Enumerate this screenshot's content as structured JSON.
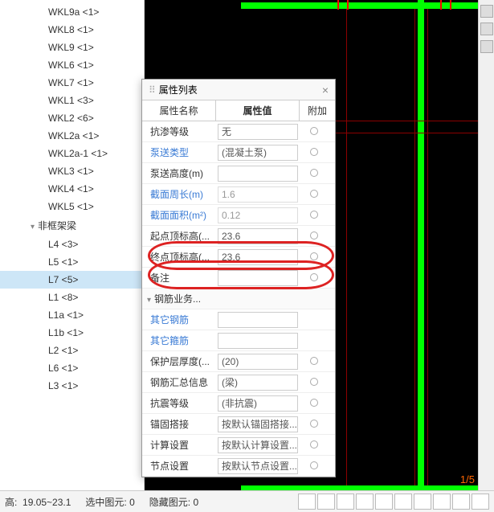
{
  "tree": {
    "items_top": [
      "WKL9a <1>",
      "WKL8 <1>",
      "WKL9 <1>",
      "WKL6 <1>",
      "WKL7 <1>",
      "WKL1 <3>",
      "WKL2 <6>",
      "WKL2a <1>",
      "WKL2a-1 <1>",
      "WKL3 <1>",
      "WKL4 <1>",
      "WKL5 <1>"
    ],
    "group": "非框架梁",
    "items_bot": [
      "L4 <3>",
      "L5 <1>",
      "L7 <5>",
      "L1 <8>",
      "L1a <1>",
      "L1b <1>",
      "L2 <1>",
      "L6 <1>",
      "L3 <1>"
    ],
    "selected": "L7 <5>"
  },
  "prop": {
    "title": "属性列表",
    "headers": {
      "name": "属性名称",
      "value": "属性值",
      "extra": "附加"
    },
    "rows": [
      {
        "name": "抗渗等级",
        "value": "无",
        "link": false,
        "readonly": false,
        "radio": true
      },
      {
        "name": "泵送类型",
        "value": "(混凝土泵)",
        "link": true,
        "readonly": false,
        "radio": true
      },
      {
        "name": "泵送高度(m)",
        "value": "",
        "link": false,
        "readonly": false,
        "radio": true
      },
      {
        "name": "截面周长(m)",
        "value": "1.6",
        "link": true,
        "readonly": true,
        "radio": true
      },
      {
        "name": "截面面积(m²)",
        "value": "0.12",
        "link": true,
        "readonly": true,
        "radio": true
      },
      {
        "name": "起点顶标高(...",
        "value": "23.6",
        "link": false,
        "readonly": false,
        "radio": true
      },
      {
        "name": "终点顶标高(...",
        "value": "23.6",
        "link": false,
        "readonly": false,
        "radio": true
      },
      {
        "name": "备注",
        "value": "",
        "link": false,
        "readonly": false,
        "radio": true
      }
    ],
    "group2": "钢筋业务...",
    "rows2": [
      {
        "name": "其它钢筋",
        "value": "",
        "link": true,
        "readonly": false,
        "radio": false
      },
      {
        "name": "其它箍筋",
        "value": "",
        "link": true,
        "readonly": false,
        "radio": false
      },
      {
        "name": "保护层厚度(...",
        "value": "(20)",
        "link": false,
        "readonly": false,
        "radio": true
      },
      {
        "name": "钢筋汇总信息",
        "value": "(梁)",
        "link": false,
        "readonly": false,
        "radio": true
      },
      {
        "name": "抗震等级",
        "value": "(非抗震)",
        "link": false,
        "readonly": false,
        "radio": true
      },
      {
        "name": "锚固搭接",
        "value": "按默认锚固搭接...",
        "link": false,
        "readonly": false,
        "radio": true
      },
      {
        "name": "计算设置",
        "value": "按默认计算设置...",
        "link": false,
        "readonly": false,
        "radio": true
      },
      {
        "name": "节点设置",
        "value": "按默认节点设置...",
        "link": false,
        "readonly": false,
        "radio": true
      }
    ]
  },
  "canvas": {
    "scale": "1/5"
  },
  "status": {
    "elev_label": "高:",
    "elev_value": "19.05~23.1",
    "sel_label": "选中图元:",
    "sel_value": "0",
    "hid_label": "隐藏图元:",
    "hid_value": "0"
  }
}
